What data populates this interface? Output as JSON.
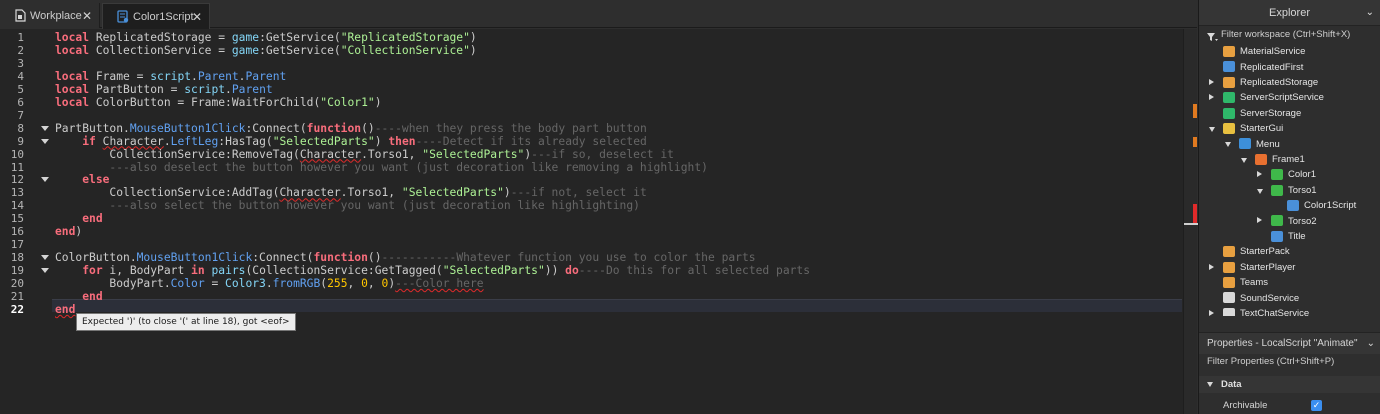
{
  "tabs": [
    {
      "label": "Workplace",
      "close": "✕"
    },
    {
      "label": "Color1Script",
      "close": "✕"
    }
  ],
  "editor": {
    "line_numbers": [
      "1",
      "2",
      "3",
      "4",
      "5",
      "6",
      "7",
      "8",
      "9",
      "10",
      "11",
      "12",
      "13",
      "14",
      "15",
      "16",
      "17",
      "18",
      "19",
      "20",
      "21",
      "22"
    ],
    "lines": [
      [
        {
          "t": "local",
          "c": "k"
        },
        {
          "t": " ReplicatedStorage = "
        },
        {
          "t": "game",
          "c": "bi"
        },
        {
          "t": ":GetService("
        },
        {
          "t": "\"ReplicatedStorage\"",
          "c": "s"
        },
        {
          "t": ")"
        }
      ],
      [
        {
          "t": "local",
          "c": "k"
        },
        {
          "t": " CollectionService = "
        },
        {
          "t": "game",
          "c": "bi"
        },
        {
          "t": ":GetService("
        },
        {
          "t": "\"CollectionService\"",
          "c": "s"
        },
        {
          "t": ")"
        }
      ],
      [],
      [
        {
          "t": "local",
          "c": "k"
        },
        {
          "t": " Frame = "
        },
        {
          "t": "script",
          "c": "bi"
        },
        {
          "t": "."
        },
        {
          "t": "Parent",
          "c": "p"
        },
        {
          "t": "."
        },
        {
          "t": "Parent",
          "c": "p"
        }
      ],
      [
        {
          "t": "local",
          "c": "k"
        },
        {
          "t": " PartButton = "
        },
        {
          "t": "script",
          "c": "bi"
        },
        {
          "t": "."
        },
        {
          "t": "Parent",
          "c": "p"
        }
      ],
      [
        {
          "t": "local",
          "c": "k"
        },
        {
          "t": " ColorButton = Frame:WaitForChild("
        },
        {
          "t": "\"Color1\"",
          "c": "s"
        },
        {
          "t": ")"
        }
      ],
      [],
      [
        {
          "t": "PartButton."
        },
        {
          "t": "MouseButton1Click",
          "c": "p"
        },
        {
          "t": ":Connect("
        },
        {
          "t": "function",
          "c": "k"
        },
        {
          "t": "()"
        },
        {
          "t": "----when they press the body part button",
          "c": "c"
        }
      ],
      [
        {
          "t": "    "
        },
        {
          "t": "if",
          "c": "k"
        },
        {
          "t": " "
        },
        {
          "t": "Character",
          "c": "err"
        },
        {
          "t": "."
        },
        {
          "t": "LeftLeg",
          "c": "p"
        },
        {
          "t": ":HasTag("
        },
        {
          "t": "\"SelectedParts\"",
          "c": "s"
        },
        {
          "t": ") "
        },
        {
          "t": "then",
          "c": "k"
        },
        {
          "t": "----Detect if its already selected",
          "c": "c"
        }
      ],
      [
        {
          "t": "        CollectionService:RemoveTag("
        },
        {
          "t": "Character",
          "c": "err"
        },
        {
          "t": ".Torso1, "
        },
        {
          "t": "\"SelectedParts\"",
          "c": "s"
        },
        {
          "t": ")"
        },
        {
          "t": "---if so, deselect it",
          "c": "c"
        }
      ],
      [
        {
          "t": "        "
        },
        {
          "t": "---also deselect the button however you want (just decoration like removing a highlight)",
          "c": "c"
        }
      ],
      [
        {
          "t": "    "
        },
        {
          "t": "else",
          "c": "k"
        }
      ],
      [
        {
          "t": "        CollectionService:AddTag("
        },
        {
          "t": "Character",
          "c": "err"
        },
        {
          "t": ".Torso1, "
        },
        {
          "t": "\"SelectedParts\"",
          "c": "s"
        },
        {
          "t": ")"
        },
        {
          "t": "---if not, select it",
          "c": "c"
        }
      ],
      [
        {
          "t": "        "
        },
        {
          "t": "---also select the button however you want (just decoration like highlighting)",
          "c": "c"
        }
      ],
      [
        {
          "t": "    "
        },
        {
          "t": "end",
          "c": "k"
        }
      ],
      [
        {
          "t": "end",
          "c": "k"
        },
        {
          "t": ")"
        }
      ],
      [],
      [
        {
          "t": "ColorButton."
        },
        {
          "t": "MouseButton1Click",
          "c": "p"
        },
        {
          "t": ":Connect("
        },
        {
          "t": "function",
          "c": "k"
        },
        {
          "t": "()"
        },
        {
          "t": "-----------Whatever function you use to color the parts",
          "c": "c"
        }
      ],
      [
        {
          "t": "    "
        },
        {
          "t": "for",
          "c": "k"
        },
        {
          "t": " i, BodyPart "
        },
        {
          "t": "in",
          "c": "k"
        },
        {
          "t": " "
        },
        {
          "t": "pairs",
          "c": "bi"
        },
        {
          "t": "(CollectionService:GetTagged("
        },
        {
          "t": "\"SelectedParts\"",
          "c": "s"
        },
        {
          "t": ")) "
        },
        {
          "t": "do",
          "c": "k"
        },
        {
          "t": "----Do this for all selected parts",
          "c": "c"
        }
      ],
      [
        {
          "t": "        BodyPart."
        },
        {
          "t": "Color",
          "c": "p"
        },
        {
          "t": " = "
        },
        {
          "t": "Color3",
          "c": "bi"
        },
        {
          "t": "."
        },
        {
          "t": "fromRGB",
          "c": "p"
        },
        {
          "t": "("
        },
        {
          "t": "255",
          "c": "n"
        },
        {
          "t": ", "
        },
        {
          "t": "0",
          "c": "n"
        },
        {
          "t": ", "
        },
        {
          "t": "0",
          "c": "n"
        },
        {
          "t": ")"
        },
        {
          "t": "---Color here",
          "c": "c err"
        }
      ],
      [
        {
          "t": "    "
        },
        {
          "t": "end",
          "c": "k"
        }
      ],
      [
        {
          "t": "end",
          "c": "k err"
        }
      ]
    ],
    "fold_lines": [
      8,
      9,
      12,
      18,
      19
    ],
    "current_line": 22,
    "error_tooltip": "Expected ')' (to close '(' at line 18), got <eof>"
  },
  "explorer": {
    "title": "Explorer",
    "filter": "Filter workspace (Ctrl+Shift+X)",
    "items": [
      {
        "label": "MaterialService",
        "indent": 0,
        "arrow": "",
        "icon": "material-service-icon",
        "color": "#e8a040"
      },
      {
        "label": "ReplicatedFirst",
        "indent": 0,
        "arrow": "",
        "icon": "replicated-first-icon",
        "color": "#4a90d9"
      },
      {
        "label": "ReplicatedStorage",
        "indent": 0,
        "arrow": "right",
        "icon": "replicated-storage-icon",
        "color": "#e8a040"
      },
      {
        "label": "ServerScriptService",
        "indent": 0,
        "arrow": "right",
        "icon": "server-script-service-icon",
        "color": "#2fb86a"
      },
      {
        "label": "ServerStorage",
        "indent": 0,
        "arrow": "",
        "icon": "server-storage-icon",
        "color": "#2fb86a"
      },
      {
        "label": "StarterGui",
        "indent": 0,
        "arrow": "down",
        "icon": "starter-gui-icon",
        "color": "#e8c040"
      },
      {
        "label": "Menu",
        "indent": 1,
        "arrow": "down",
        "icon": "screen-gui-icon",
        "color": "#3d8fd9"
      },
      {
        "label": "Frame1",
        "indent": 2,
        "arrow": "down",
        "icon": "frame-icon",
        "color": "#e87030"
      },
      {
        "label": "Color1",
        "indent": 3,
        "arrow": "right",
        "icon": "text-button-icon",
        "color": "#3fb84a"
      },
      {
        "label": "Torso1",
        "indent": 3,
        "arrow": "down",
        "icon": "text-button-icon",
        "color": "#3fb84a"
      },
      {
        "label": "Color1Script",
        "indent": 4,
        "arrow": "",
        "icon": "local-script-icon",
        "color": "#4a90d9"
      },
      {
        "label": "Torso2",
        "indent": 3,
        "arrow": "right",
        "icon": "text-button-icon",
        "color": "#3fb84a"
      },
      {
        "label": "Title",
        "indent": 3,
        "arrow": "",
        "icon": "text-label-icon",
        "color": "#4a90d9"
      },
      {
        "label": "StarterPack",
        "indent": 0,
        "arrow": "",
        "icon": "starter-pack-icon",
        "color": "#e8a040"
      },
      {
        "label": "StarterPlayer",
        "indent": 0,
        "arrow": "right",
        "icon": "starter-player-icon",
        "color": "#e8a040"
      },
      {
        "label": "Teams",
        "indent": 0,
        "arrow": "",
        "icon": "teams-icon",
        "color": "#e8a040"
      },
      {
        "label": "SoundService",
        "indent": 0,
        "arrow": "",
        "icon": "sound-service-icon",
        "color": "#d9d9d9"
      },
      {
        "label": "TextChatService",
        "indent": 0,
        "arrow": "right",
        "icon": "text-chat-service-icon",
        "color": "#d9d9d9"
      }
    ]
  },
  "properties": {
    "title": "Properties - LocalScript \"Animate\"",
    "filter": "Filter Properties (Ctrl+Shift+P)",
    "section": "Data",
    "archivable_label": "Archivable",
    "archivable_value": "✓"
  },
  "colors": {
    "keyword": "#f86d7c",
    "property": "#61a1f1",
    "string": "#adf195",
    "comment": "#666666",
    "number": "#ffc600",
    "builtin": "#84d6f7",
    "error_underline": "#e02a2a",
    "checkbox": "#3b8ff0"
  }
}
